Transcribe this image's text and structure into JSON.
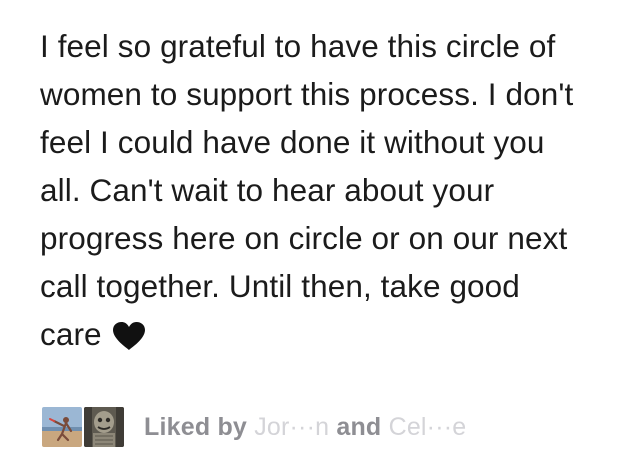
{
  "post": {
    "lines": [
      "I feel so grateful to have this circle of",
      "women to support this process. I don't",
      "feel I could have done it without you",
      "all. Can't wait to hear about your",
      "progress here on circle or on our next",
      "call together. Until then, take good",
      "care"
    ],
    "trailing_emoji": "black-heart-icon"
  },
  "likes": {
    "prefix": "Liked by",
    "first_name": "Jor···n",
    "conjunction": "and",
    "second_name": "Cel···e",
    "avatars": [
      "avatar-beach-pose",
      "avatar-stone-statue"
    ]
  },
  "colors": {
    "text": "#1b1b1b",
    "muted": "#8e8e93",
    "blurred_name": "#d4d4d8",
    "heart": "#111111"
  }
}
